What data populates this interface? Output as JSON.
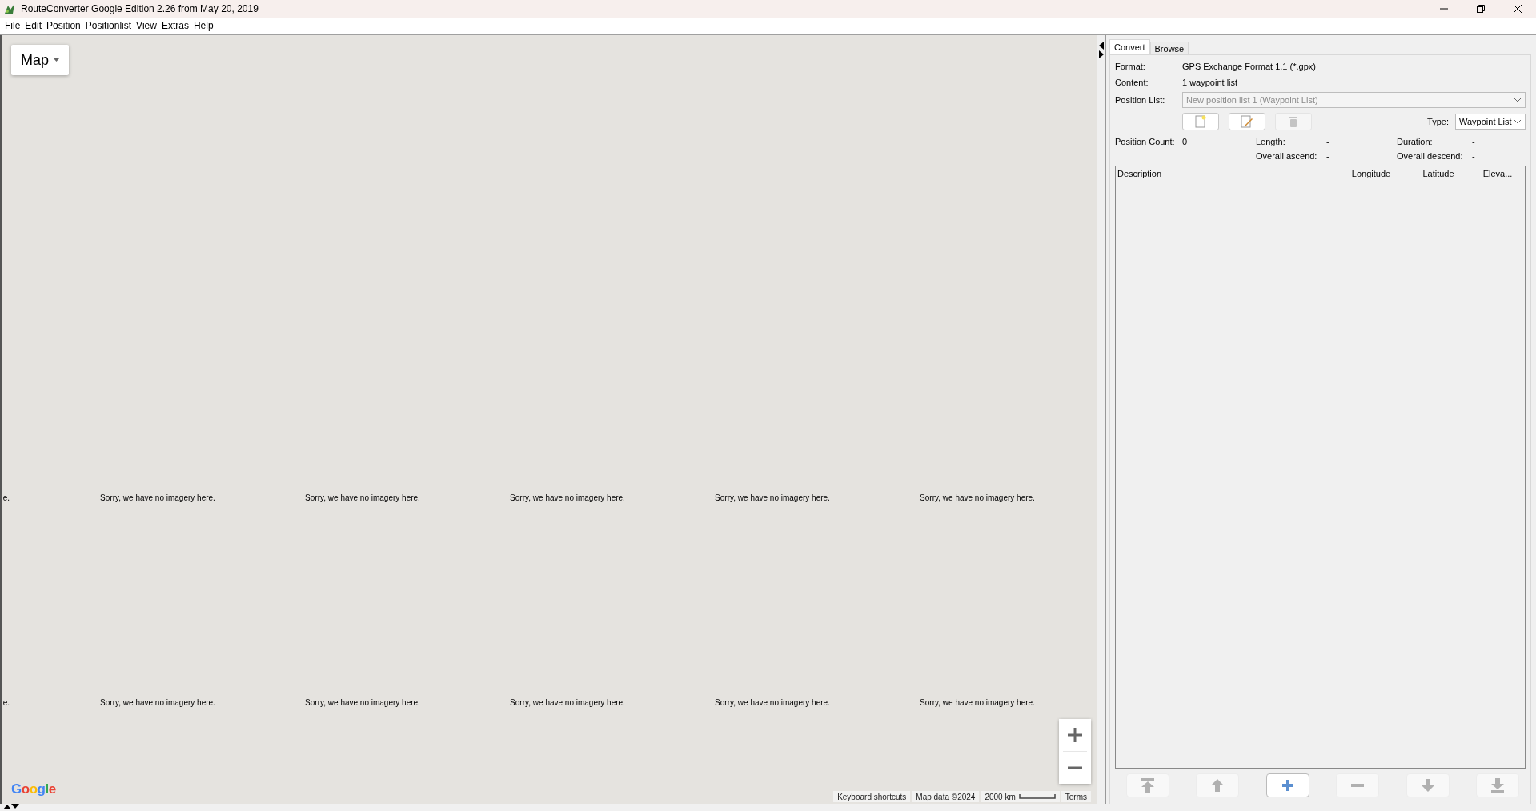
{
  "window": {
    "title": "RouteConverter Google Edition 2.26 from May 20, 2019"
  },
  "menu": [
    "File",
    "Edit",
    "Position",
    "Positionlist",
    "View",
    "Extras",
    "Help"
  ],
  "map": {
    "type_button": "Map",
    "tile_rows": [
      [
        "e.",
        "Sorry, we have no imagery here.",
        "Sorry, we have no imagery here.",
        "Sorry, we have no imagery here.",
        "Sorry, we have no imagery here.",
        "Sorry, we have no imagery here."
      ],
      [
        "e.",
        "Sorry, we have no imagery here.",
        "Sorry, we have no imagery here.",
        "Sorry, we have no imagery here.",
        "Sorry, we have no imagery here.",
        "Sorry, we have no imagery here."
      ]
    ],
    "logo": "Google",
    "attribution": {
      "shortcuts": "Keyboard shortcuts",
      "data": "Map data ©2024",
      "scale": "2000 km",
      "terms": "Terms"
    }
  },
  "panel": {
    "tabs": [
      {
        "label": "Convert",
        "selected": true
      },
      {
        "label": "Browse",
        "selected": false
      }
    ],
    "format": {
      "label": "Format:",
      "value": "GPS Exchange Format 1.1 (*.gpx)"
    },
    "content": {
      "label": "Content:",
      "value": "1 waypoint list"
    },
    "position_list": {
      "label": "Position List:",
      "value": "New position list 1 (Waypoint List)",
      "disabled": true
    },
    "list_buttons": [
      {
        "kind": "new",
        "disabled": false
      },
      {
        "kind": "edit",
        "disabled": false
      },
      {
        "kind": "delete",
        "disabled": true
      }
    ],
    "type": {
      "label": "Type:",
      "value": "Waypoint List"
    },
    "stats": [
      {
        "label": "Position Count:",
        "value": "0"
      },
      {
        "label": "Length:",
        "value": "-"
      },
      {
        "label": "Duration:",
        "value": "-"
      },
      {
        "label": "Overall ascend:",
        "value": "-"
      },
      {
        "label": "Overall descend:",
        "value": "-"
      }
    ],
    "table": {
      "columns": [
        "Description",
        "Longitude",
        "Latitude",
        "Eleva..."
      ]
    },
    "row_buttons": [
      {
        "kind": "top",
        "disabled": true
      },
      {
        "kind": "up",
        "disabled": true
      },
      {
        "kind": "add",
        "disabled": false
      },
      {
        "kind": "remove",
        "disabled": true
      },
      {
        "kind": "down",
        "disabled": true
      },
      {
        "kind": "bottom",
        "disabled": true
      }
    ]
  }
}
